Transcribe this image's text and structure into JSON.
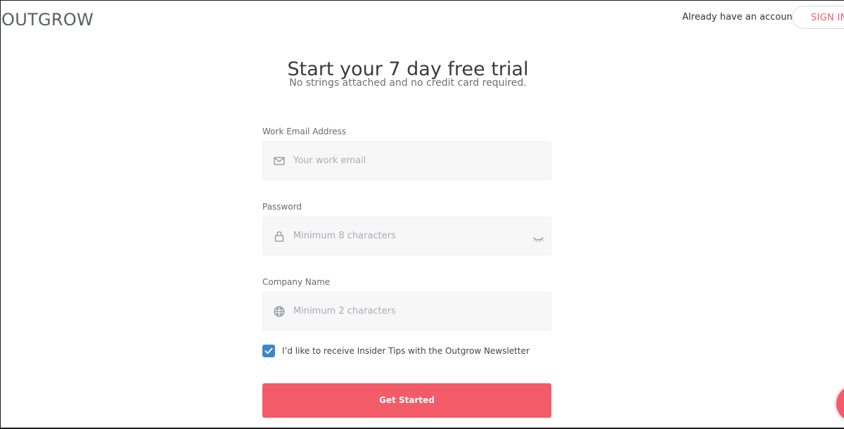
{
  "header": {
    "logo_text": "OUTGROW",
    "account_prompt": "Already have an account?",
    "signin_label": "SIGN IN"
  },
  "hero": {
    "title": "Start your 7 day free trial",
    "subtitle": "No strings attached and no credit card required."
  },
  "form": {
    "email": {
      "label": "Work Email Address",
      "placeholder": "Your work email",
      "value": "",
      "icon": "mail-icon"
    },
    "password": {
      "label": "Password",
      "placeholder": "Minimum 8 characters",
      "value": "",
      "icon": "lock-icon",
      "toggle_icon": "eye-closed-icon"
    },
    "company": {
      "label": "Company Name",
      "placeholder": "Minimum 2 characters",
      "value": "",
      "icon": "globe-icon"
    },
    "newsletter": {
      "checked": true,
      "label": "I’d like to receive Insider Tips with the Outgrow Newsletter"
    },
    "submit_label": "Get Started"
  },
  "colors": {
    "accent": "#f45b69",
    "checkbox": "#3a87c9",
    "field_bg": "#f7f7f7",
    "placeholder": "#a9acb3"
  }
}
